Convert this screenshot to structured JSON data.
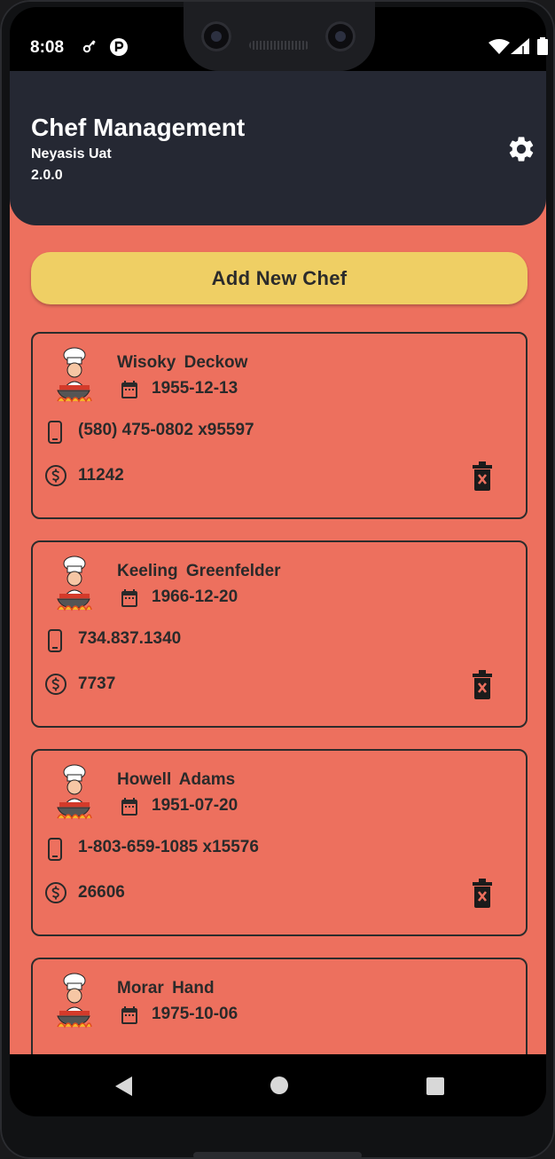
{
  "status_bar": {
    "time": "8:08"
  },
  "header": {
    "title": "Chef Management",
    "subtitle": "Neyasis Uat",
    "version": "2.0.0"
  },
  "add_button_label": "Add New Chef",
  "chefs": [
    {
      "name": "Wisoky  Deckow",
      "dob": "1955-12-13",
      "phone": "(580) 475-0802 x95597",
      "salary": "11242"
    },
    {
      "name": "Keeling  Greenfelder",
      "dob": "1966-12-20",
      "phone": "734.837.1340",
      "salary": "7737"
    },
    {
      "name": "Howell  Adams",
      "dob": "1951-07-20",
      "phone": "1-803-659-1085 x15576",
      "salary": "26606"
    },
    {
      "name": "Morar  Hand",
      "dob": "1975-10-06",
      "phone": "",
      "salary": ""
    }
  ],
  "colors": {
    "background": "#ed705e",
    "header": "#252833",
    "accent_button": "#efcf64",
    "text": "#2a2a2a"
  },
  "icons": [
    "key-icon",
    "p-badge-icon",
    "wifi-icon",
    "signal-icon",
    "battery-icon",
    "settings-gear-icon",
    "chef-avatar-icon",
    "calendar-icon",
    "phone-icon",
    "dollar-icon",
    "delete-icon",
    "back-icon",
    "home-icon",
    "recent-apps-icon"
  ]
}
